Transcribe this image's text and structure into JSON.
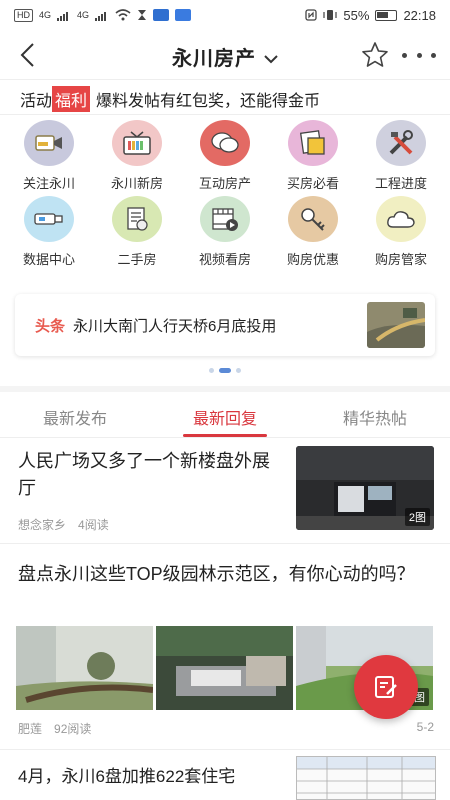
{
  "status_bar": {
    "left": [
      "HD",
      "4G",
      "4G"
    ],
    "battery": "55%",
    "time": "22:18"
  },
  "nav": {
    "title": "永川房产",
    "back_icon": "back-arrow-icon",
    "dropdown_icon": "chevron-down-icon",
    "favorite_icon": "star-icon",
    "more_icon": "more-dots-icon"
  },
  "promo": {
    "prefix": "活动",
    "highlight": "福利",
    "text": "爆料发帖有红包奖，还能得金币",
    "highlight_color": "#e64545"
  },
  "grid": [
    {
      "label": "关注永川",
      "icon": "video-camera-icon",
      "bg": "#c8c9dd"
    },
    {
      "label": "永川新房",
      "icon": "tv-icon",
      "bg": "#f2c7c7"
    },
    {
      "label": "互动房产",
      "icon": "chat-bubbles-icon",
      "bg": "#e36a64"
    },
    {
      "label": "买房必看",
      "icon": "notes-icon",
      "bg": "#e8b6d9"
    },
    {
      "label": "工程进度",
      "icon": "tools-icon",
      "bg": "#cfd0de"
    },
    {
      "label": "数据中心",
      "icon": "usb-drive-icon",
      "bg": "#bfe3f3"
    },
    {
      "label": "二手房",
      "icon": "document-icon",
      "bg": "#d8e8b3"
    },
    {
      "label": "视频看房",
      "icon": "film-icon",
      "bg": "#cfe6cf"
    },
    {
      "label": "购房优惠",
      "icon": "key-icon",
      "bg": "#e6c9a3"
    },
    {
      "label": "购房管家",
      "icon": "cloud-icon",
      "bg": "#f1efc2"
    }
  ],
  "headline": {
    "tag": "头条",
    "text": "永川大南门人行天桥6月底投用"
  },
  "tabs": [
    "最新发布",
    "最新回复",
    "精华热帖"
  ],
  "active_tab": 1,
  "posts": [
    {
      "title": "人民广场又多了一个新楼盘外展厅",
      "author": "想念家乡",
      "reads": "4阅读",
      "image_count": "2图"
    },
    {
      "title": "盘点永川这些TOP级园林示范区，有你心动的吗？",
      "author": "肥莲",
      "reads": "92阅读",
      "date": "5-2",
      "image_count": "6图"
    },
    {
      "title": "4月，永川6盘加推622套住宅"
    }
  ],
  "fab_icon": "edit-post-icon",
  "colors": {
    "accent": "#d9373e",
    "tag": "#e85a4f"
  }
}
